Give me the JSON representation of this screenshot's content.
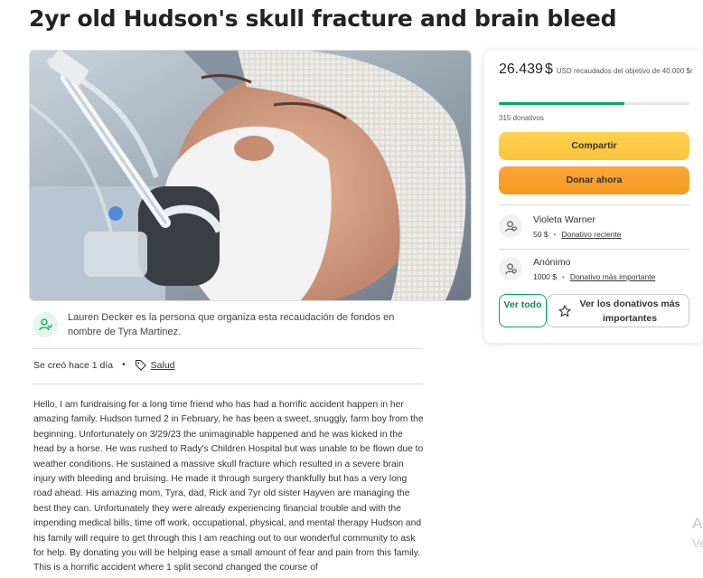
{
  "campaign": {
    "title": "2yr old Hudson's skull fracture and brain bleed"
  },
  "organizer": {
    "text": "Lauren Decker es la persona que organiza esta recaudación de fondos en nombre de Tyra Martinez."
  },
  "meta": {
    "created": "Se creó hace 1 día",
    "category": "Salud"
  },
  "story": {
    "text": "Hello, I am fundraising for a long time friend who has had a horrific accident happen in her amazing family. Hudson turned 2 in February, he has been a sweet, snuggly, farm boy from the beginning. Unfortunately on 3/29/23 the unimaginable happened and he was kicked in the head by a horse. He was rushed to Rady's Children Hospital but was unable to be flown due to weather conditions. He sustained a massive skull fracture which resulted in a severe brain injury with bleeding and bruising. He made it through surgery thankfully but has a very long road ahead. His amazing mom, Tyra, dad, Rick and 7yr old sister Hayven are managing the best they can. Unfortunately they were already experiencing financial trouble and with the impending medical bills, time off work, occupational, physical, and mental therapy Hudson and his family will require to get through this I am reaching out to our wonderful community to ask for help. By donating you will be helping ease a small amount of fear and pain from this family. This is a horrific accident where 1 split second changed the course of"
  },
  "sidebar": {
    "raised_amount": "26.439",
    "currency_symbol": "$",
    "raised_suffix": "USD recaudados del objetivo de 40.000 $r",
    "progress_fraction": 0.66,
    "donor_count": "315 donativos",
    "share_label": "Compartir",
    "donate_label": "Donar ahora",
    "donations": [
      {
        "name": "Violeta Warner",
        "amount": "50 $",
        "label": "Donativo reciente"
      },
      {
        "name": "Anónimo",
        "amount": "1000 $",
        "label": "Donativo más importante"
      }
    ],
    "see_all_label": "Ver todo",
    "see_top_label": "Ver los donativos más importantes"
  },
  "colors": {
    "accent_green": "#02a95c",
    "share_yellow": "#fbc43c",
    "donate_orange": "#f59a1f"
  },
  "edge_fragment": {
    "line1": "A",
    "line2": "Ve"
  }
}
